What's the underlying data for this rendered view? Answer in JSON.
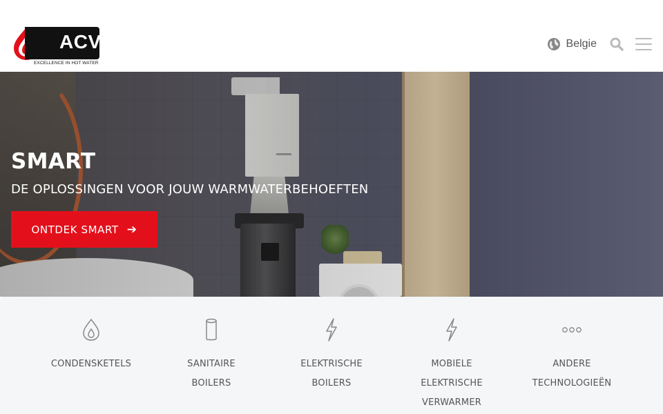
{
  "header": {
    "logo_text": "ACV",
    "logo_tagline": "EXCELLENCE IN HOT WATER",
    "language": "Belgie",
    "icons": {
      "globe": "globe-icon",
      "search": "search-icon",
      "menu": "hamburger-menu-icon"
    }
  },
  "hero": {
    "title": "SMART",
    "subtitle": "DE OPLOSSINGEN VOOR JOUW WARMWATERBEHOEFTEN",
    "cta_label": "ONTDEK SMART",
    "cta_icon": "arrow-right-icon"
  },
  "categories": [
    {
      "icon": "flame-drop-icon",
      "lines": [
        "CONDENSKETELS"
      ]
    },
    {
      "icon": "cylinder-icon",
      "lines": [
        "SANITAIRE",
        "BOILERS"
      ]
    },
    {
      "icon": "lightning-icon",
      "lines": [
        "ELEKTRISCHE",
        "BOILERS"
      ]
    },
    {
      "icon": "lightning-icon",
      "lines": [
        "MOBIELE",
        "ELEKTRISCHE",
        "VERWARMER"
      ]
    },
    {
      "icon": "dots-icon",
      "lines": [
        "ANDERE",
        "TECHNOLOGIEËN"
      ]
    }
  ],
  "colors": {
    "brand_red": "#e3101c",
    "logo_black": "#111111",
    "category_bg": "#f4f6f8",
    "text_gray": "#555555"
  }
}
